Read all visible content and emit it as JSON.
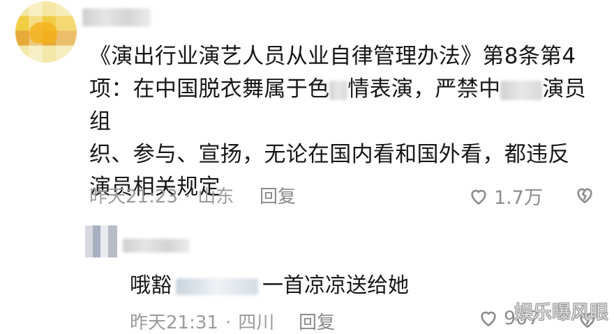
{
  "comment": {
    "text": "《演出行业演艺人员从业自律管理办法》第8条第4项：在中国脱衣舞属于色情表演，严禁中国演员组织、参与、宣扬，无论在国内看和国外看，都违反演员相关规定",
    "line1": "《演出行业演艺人员从业自律管理办法》第8条第4",
    "line2_a": "项：在中国脱衣舞属于色",
    "line2_b": "情表演，严禁中",
    "line2_c": "演员组",
    "line3": "织、参与、宣扬，无论在国内看和国外看，都违反",
    "line4": "演员相关规定",
    "time": "昨天21:23",
    "location": "山东",
    "reply_label": "回复",
    "likes": "1.7万"
  },
  "reply": {
    "text_start": "哦豁",
    "text_end": "一首凉凉送给她",
    "time": "昨天21:31",
    "location": "四川",
    "reply_label": "回复",
    "likes": "907"
  },
  "icons": {
    "like": "heart-outline-icon",
    "dislike": "broken-heart-icon"
  },
  "watermark": "娱乐曝风眼",
  "colors": {
    "text": "#161616",
    "meta": "#9a9a9a",
    "icon": "#8c8c8c"
  }
}
